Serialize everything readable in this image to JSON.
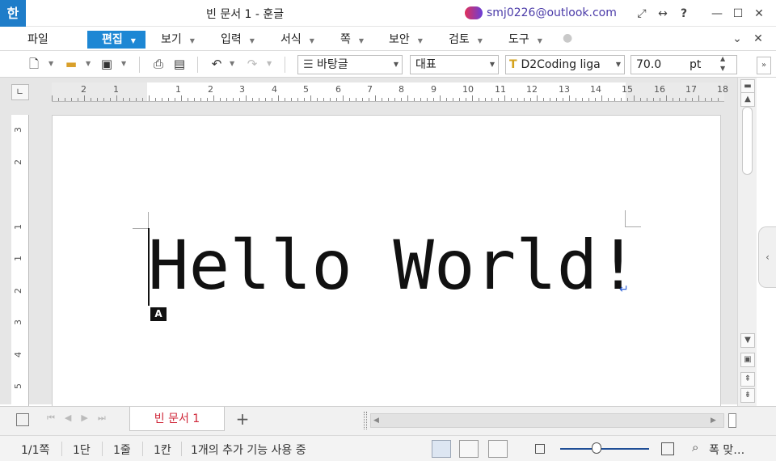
{
  "app": {
    "logo_text": "한",
    "title": "빈 문서 1 - 훈글"
  },
  "account": {
    "email": "smj0226@outlook.com"
  },
  "title_controls": {
    "fullscreen": "⤢",
    "ribbon_toggle": "↔",
    "help": "?",
    "minimize": "—",
    "maximize": "☐",
    "close": "✕"
  },
  "menu": [
    {
      "label": "파일",
      "dropdown": false
    },
    {
      "label": "편집",
      "dropdown": true
    },
    {
      "label": "보기",
      "dropdown": true
    },
    {
      "label": "입력",
      "dropdown": true
    },
    {
      "label": "서식",
      "dropdown": true
    },
    {
      "label": "쪽",
      "dropdown": true
    },
    {
      "label": "보안",
      "dropdown": true
    },
    {
      "label": "검토",
      "dropdown": true
    },
    {
      "label": "도구",
      "dropdown": true
    }
  ],
  "menu_right": {
    "collapse": "⌄",
    "close": "✕"
  },
  "toolbar": {
    "style_value": "바탕글",
    "lang_value": "대표",
    "font_value": "D2Coding liga",
    "size_value": "70.0",
    "size_unit": "pt"
  },
  "ruler": {
    "h_labels": [
      "2",
      "1",
      "1",
      "2",
      "3",
      "4",
      "5",
      "6",
      "7",
      "8",
      "9",
      "10",
      "11",
      "12",
      "13",
      "14",
      "15",
      "16",
      "17",
      "18"
    ],
    "v_labels": [
      "3",
      "2",
      "1",
      "1",
      "2",
      "3",
      "4",
      "5"
    ]
  },
  "document": {
    "text": "Hello World!",
    "ime_indicator": "A"
  },
  "tabs": {
    "doc_tab": "빈 문서 1",
    "add_tab": "+"
  },
  "status": {
    "page": "1/1쪽",
    "column": "1단",
    "line": "1줄",
    "char": "1칸",
    "addons": "1개의 추가 기능 사용 중",
    "zoom": "폭 맞…"
  },
  "colors": {
    "accent": "#1d87d4",
    "tab_text": "#d0283a",
    "account": "#4a3aa8"
  }
}
